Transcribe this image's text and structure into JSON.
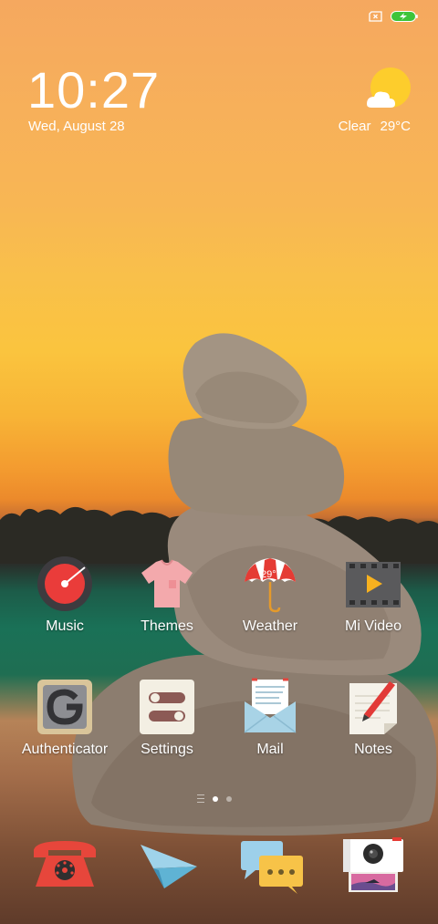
{
  "status_bar": {
    "sim_icon": "sim-card-x-icon",
    "battery_icon": "battery-charging-icon",
    "battery_color": "#3ec43a"
  },
  "clock_widget": {
    "time": "10:27",
    "date": "Wed, August 28"
  },
  "weather_widget": {
    "icon": "sun-cloud-icon",
    "condition": "Clear",
    "temperature": "29°C"
  },
  "home_apps": [
    {
      "label": "Music",
      "icon": "music-icon"
    },
    {
      "label": "Themes",
      "icon": "themes-shirt-icon"
    },
    {
      "label": "Weather",
      "icon": "weather-umbrella-icon",
      "icon_text": "29°"
    },
    {
      "label": "Mi Video",
      "icon": "video-film-icon"
    },
    {
      "label": "Authenticator",
      "icon": "authenticator-icon"
    },
    {
      "label": "Settings",
      "icon": "settings-toggles-icon"
    },
    {
      "label": "Mail",
      "icon": "mail-envelope-icon"
    },
    {
      "label": "Notes",
      "icon": "notes-pencil-icon"
    }
  ],
  "page_indicator": {
    "pages": 2,
    "active_page": 1
  },
  "dock_apps": [
    {
      "icon": "phone-icon"
    },
    {
      "icon": "paper-plane-icon"
    },
    {
      "icon": "messages-bubbles-icon"
    },
    {
      "icon": "camera-icon"
    }
  ]
}
